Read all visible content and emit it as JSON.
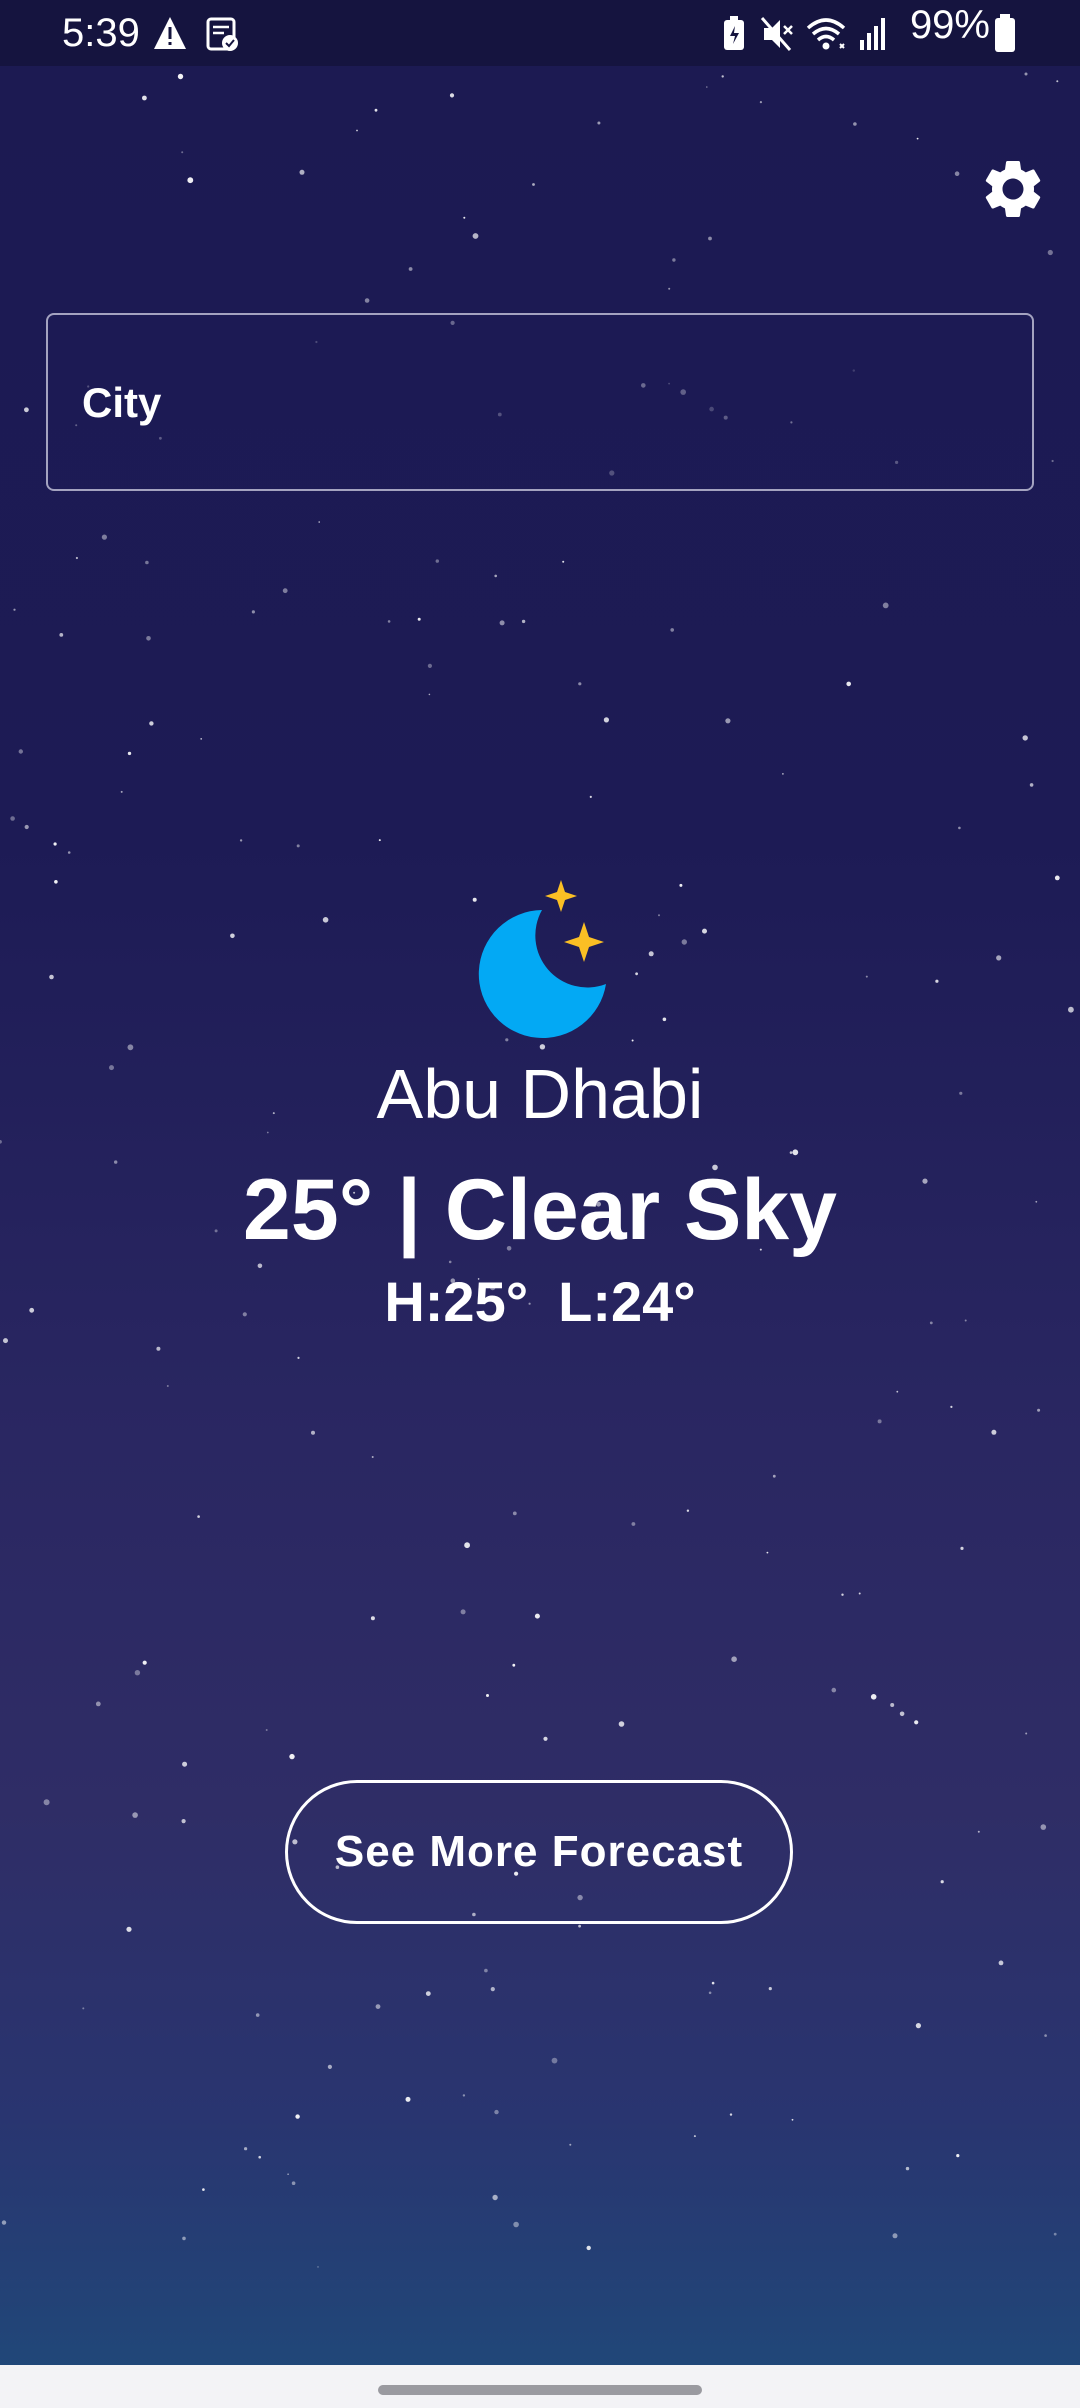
{
  "status_bar": {
    "time": "5:39",
    "battery": "99%",
    "left_icons": [
      "warning-icon",
      "clipboard-check-icon"
    ],
    "right_icons": [
      "battery-saver-icon",
      "mute-icon",
      "wifi-icon",
      "signal-icon",
      "battery-icon"
    ]
  },
  "settings": {
    "icon": "gear-icon"
  },
  "search": {
    "placeholder": "City"
  },
  "weather": {
    "icon": "moon-stars-icon",
    "city": "Abu Dhabi",
    "condition_line": "25° | Clear Sky",
    "high": "H:25°",
    "low": "L:24°"
  },
  "forecast_button": {
    "label": "See More Forecast"
  },
  "colors": {
    "background_top": "#1c1a52",
    "background_bottom": "#1f4a7a",
    "moon": "#03a9f4",
    "stars_accent": "#fbbf24",
    "text": "#ffffff"
  }
}
